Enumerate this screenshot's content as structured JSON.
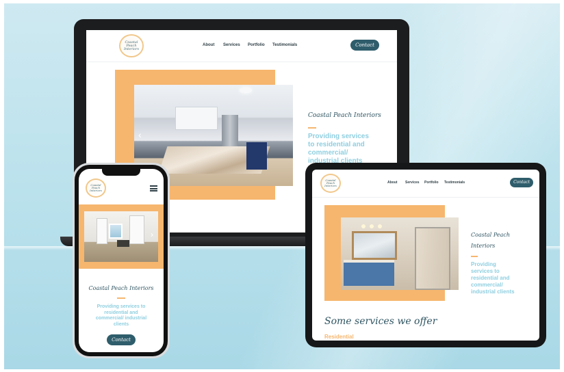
{
  "brand": {
    "logo_text": "Coastal Peach Interiors",
    "name_script": "Coastal Peach Interiors",
    "tagline": "Providing services to residential and commercial/ industrial clients",
    "tagline_laptop_lines": [
      "Providing services",
      "to residential and",
      "commercial/",
      "industrial clients"
    ],
    "tagline_tablet_lines": [
      "Providing",
      "services to",
      "residential and",
      "commercial/",
      "industrial clients"
    ],
    "tagline_phone_lines": [
      "Providing services to",
      "residential and",
      "commercial/ industrial",
      "clients"
    ],
    "tablet_name_lines": [
      "Coastal Peach",
      "Interiors"
    ]
  },
  "nav": {
    "about": "About",
    "services": "Services",
    "portfolio": "Portfolio",
    "testimonials": "Testimonials",
    "contact": "Contact"
  },
  "sections": {
    "services_heading": "Some services we offer",
    "services_first_item": "Residential"
  },
  "icons": {
    "menu": "hamburger-menu-icon",
    "prev": "chevron-left-icon",
    "next": "chevron-right-icon"
  },
  "colors": {
    "accent_peach": "#f6b66e",
    "button_teal": "#2f5d6b",
    "tagline_blue": "#8fcfe0",
    "background_sky": "#b9e1ec"
  }
}
